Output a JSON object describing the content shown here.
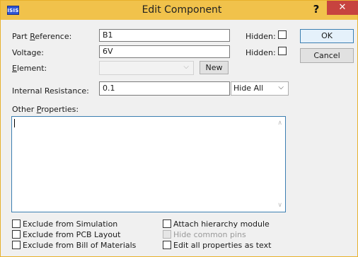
{
  "window": {
    "title": "Edit Component",
    "app_icon_text": "ISIS",
    "help": "?",
    "close": "✕"
  },
  "fields": {
    "part_reference": {
      "label_pre": "Part ",
      "label_u": "R",
      "label_post": "eference:",
      "value": "B1",
      "hidden_label": "Hidden:"
    },
    "voltage": {
      "label": "Voltage:",
      "value": "6V",
      "hidden_label": "Hidden:"
    },
    "element": {
      "label_u": "E",
      "label_post": "lement:",
      "value": "",
      "new_button": "New"
    },
    "internal_resistance": {
      "label": "Internal Resistance:",
      "value": "0.1",
      "visibility": "Hide All"
    },
    "other_properties": {
      "label_pre": "Other ",
      "label_u": "P",
      "label_post": "roperties:",
      "value": ""
    }
  },
  "buttons": {
    "ok": "OK",
    "cancel": "Cancel"
  },
  "options": {
    "exclude_simulation": "Exclude from Simulation",
    "exclude_pcb": "Exclude from PCB Layout",
    "exclude_bom": "Exclude from Bill of Materials",
    "attach_hierarchy": "Attach hierarchy module",
    "hide_common_pins": "Hide common pins",
    "edit_as_text": "Edit all properties as text"
  },
  "colors": {
    "titlebar": "#f1c24b",
    "close": "#c7433f",
    "focus": "#3c7fb1"
  }
}
